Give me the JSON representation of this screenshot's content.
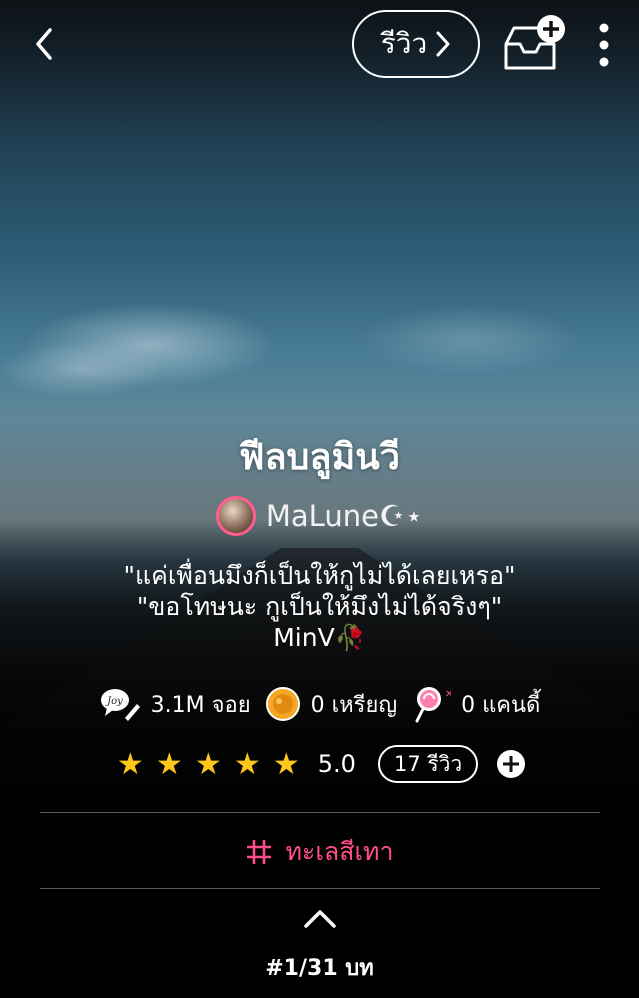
{
  "header": {
    "review_button_label": "รีวิว"
  },
  "novel": {
    "title": "ฟีลบลูมินวี",
    "author": "MaLune☪︎⋆",
    "synopsis_lines": [
      "\"แค่เพื่อนมึงก็เป็นให้กูไม่ได้เลยเหรอ\"",
      "\"ขอโทษนะ กูเป็นให้มึงไม่ได้จริงๆ\"",
      "MinV🥀"
    ]
  },
  "stats": {
    "joy": "3.1M จอย",
    "coins": "0 เหรียญ",
    "candy": "0 แคนดี้"
  },
  "rating": {
    "stars": 5,
    "value": "5.0",
    "reviews": "17 รีวิว"
  },
  "tag": "ทะเลสีเทา",
  "chapter": "#1/31 บท",
  "colors": {
    "accent_pink": "#ff4f84",
    "star_yellow": "#ffc61a",
    "coin_orange": "#f5a623"
  },
  "icons": [
    "back-arrow-icon",
    "chevron-right-icon",
    "library-add-icon",
    "more-vertical-icon",
    "joy-icon",
    "coin-icon",
    "candy-icon",
    "star-icon",
    "plus-circle-icon",
    "hashtag-icon",
    "chevron-up-icon"
  ]
}
